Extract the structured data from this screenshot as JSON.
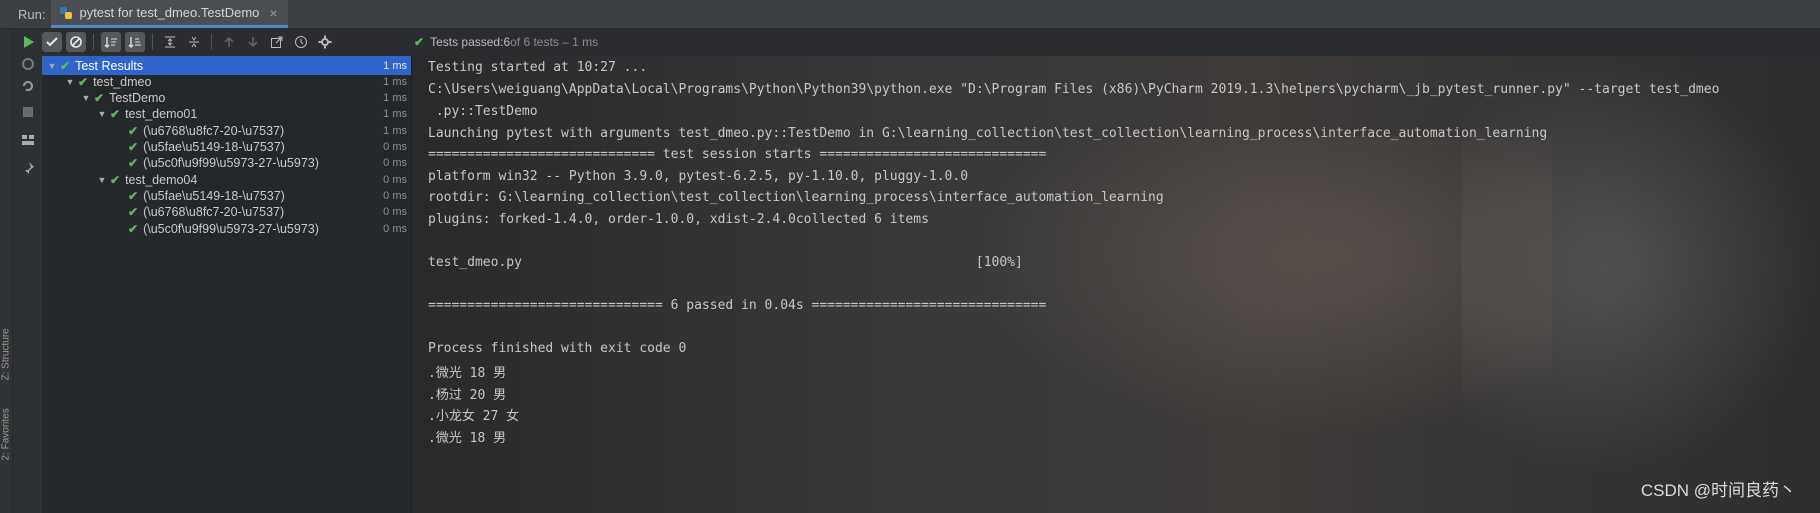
{
  "titlebar": {
    "run_label": "Run:",
    "tab_label": "pytest for test_dmeo.TestDemo",
    "close_glyph": "×"
  },
  "left_strip": {
    "structure_label": "Z: Structure",
    "favorites_label": "2: Favorites"
  },
  "status": {
    "prefix": "Tests passed: ",
    "count": "6",
    "suffix": " of 6 tests – 1 ms"
  },
  "tree": [
    {
      "label": "Test Results",
      "time": "1 ms",
      "level": 0,
      "expanded": true,
      "selected": true
    },
    {
      "label": "test_dmeo",
      "time": "1 ms",
      "level": 1,
      "expanded": true
    },
    {
      "label": "TestDemo",
      "time": "1 ms",
      "level": 2,
      "expanded": true
    },
    {
      "label": "test_demo01",
      "time": "1 ms",
      "level": 3,
      "expanded": true
    },
    {
      "label": "(\\u6768\\u8fc7-20-\\u7537)",
      "time": "1 ms",
      "level": 4
    },
    {
      "label": "(\\u5fae\\u5149-18-\\u7537)",
      "time": "0 ms",
      "level": 4
    },
    {
      "label": "(\\u5c0f\\u9f99\\u5973-27-\\u5973)",
      "time": "0 ms",
      "level": 4
    },
    {
      "label": "test_demo04",
      "time": "0 ms",
      "level": 3,
      "expanded": true
    },
    {
      "label": "(\\u5fae\\u5149-18-\\u7537)",
      "time": "0 ms",
      "level": 4
    },
    {
      "label": "(\\u6768\\u8fc7-20-\\u7537)",
      "time": "0 ms",
      "level": 4
    },
    {
      "label": "(\\u5c0f\\u9f99\\u5973-27-\\u5973)",
      "time": "0 ms",
      "level": 4
    }
  ],
  "console": {
    "lines": [
      "Testing started at 10:27 ...",
      "C:\\Users\\weiguang\\AppData\\Local\\Programs\\Python\\Python39\\python.exe \"D:\\Program Files (x86)\\PyCharm 2019.1.3\\helpers\\pycharm\\_jb_pytest_runner.py\" --target test_dmeo",
      " .py::TestDemo",
      "Launching pytest with arguments test_dmeo.py::TestDemo in G:\\learning_collection\\test_collection\\learning_process\\interface_automation_learning",
      "============================= test session starts =============================",
      "platform win32 -- Python 3.9.0, pytest-6.2.5, py-1.10.0, pluggy-1.0.0",
      "rootdir: G:\\learning_collection\\test_collection\\learning_process\\interface_automation_learning",
      "plugins: forked-1.4.0, order-1.0.0, xdist-2.4.0collected 6 items",
      "",
      "test_dmeo.py                                                          [100%]",
      "",
      "============================== 6 passed in 0.04s ==============================",
      "",
      "Process finished with exit code 0",
      ".微光 18 男",
      ".杨过 20 男",
      ".小龙女 27 女",
      ".微光 18 男"
    ]
  },
  "watermark": "CSDN @时间良药丶",
  "colors": {
    "accent_blue": "#2f65ca",
    "pass_green": "#5fb85a",
    "panel_bg": "#25282b",
    "toolbar_bg": "#3c3f41"
  }
}
